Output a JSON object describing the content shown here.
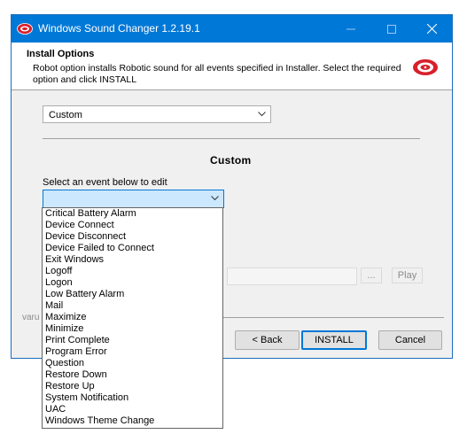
{
  "window": {
    "title": "Windows Sound Changer 1.2.19.1"
  },
  "header": {
    "title": "Install Options",
    "description": "Robot option installs Robotic sound for all events specified in Installer. Select the required option and click INSTALL"
  },
  "mode_select": {
    "selected": "Custom"
  },
  "section": {
    "title": "Custom",
    "event_label": "Select an event below to edit"
  },
  "event_select": {
    "selected": ""
  },
  "event_options": [
    "Critical Battery Alarm",
    "Device Connect",
    "Device Disconnect",
    "Device Failed to Connect",
    "Exit Windows",
    "Logoff",
    "Logon",
    "Low Battery Alarm",
    "Mail",
    "Maximize",
    "Minimize",
    "Print Complete",
    "Program Error",
    "Question",
    "Restore Down",
    "Restore Up",
    "System Notification",
    "UAC",
    "Windows Theme Change"
  ],
  "sound_controls": {
    "browse_label": "...",
    "play_label": "Play"
  },
  "footer": {
    "side_text": "varu",
    "back_label": "< Back",
    "install_label": "INSTALL",
    "cancel_label": "Cancel"
  },
  "colors": {
    "titlebar": "#0078d7",
    "logo_red": "#d8202a"
  }
}
